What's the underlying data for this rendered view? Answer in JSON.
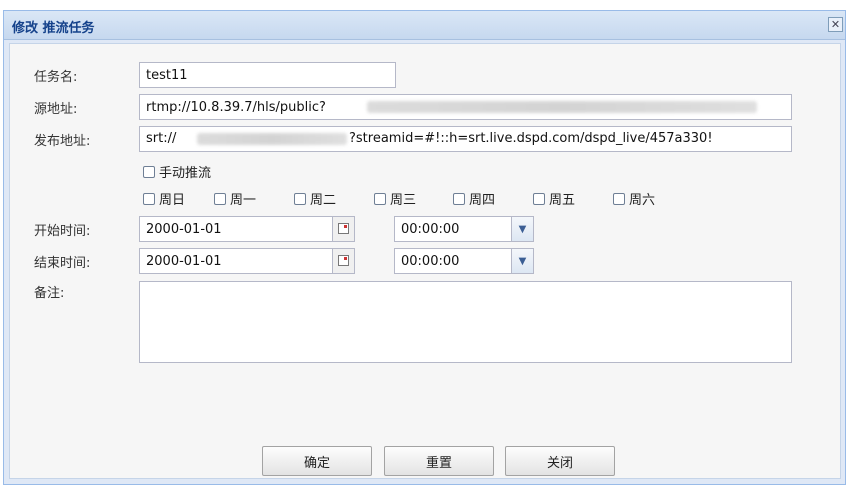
{
  "dialog": {
    "title": "修改 推流任务",
    "close_symbol": "✕"
  },
  "form": {
    "task_name": {
      "label": "任务名:",
      "value": "test11"
    },
    "source_url": {
      "label": "源地址:",
      "value": "rtmp://10.8.39.7/hls/public?"
    },
    "publish_url": {
      "label": "发布地址:",
      "prefix": "srt://",
      "suffix": "?streamid=#!::h=srt.live.dspd.com/dspd_live/457a330!"
    },
    "manual_push": {
      "label": "手动推流"
    },
    "weekdays": [
      "周日",
      "周一",
      "周二",
      "周三",
      "周四",
      "周五",
      "周六"
    ],
    "start_time": {
      "label": "开始时间:",
      "date": "2000-01-01",
      "time": "00:00:00"
    },
    "end_time": {
      "label": "结束时间:",
      "date": "2000-01-01",
      "time": "00:00:00"
    },
    "notes": {
      "label": "备注:",
      "value": ""
    }
  },
  "buttons": {
    "confirm": "确定",
    "reset": "重置",
    "close": "关闭"
  }
}
